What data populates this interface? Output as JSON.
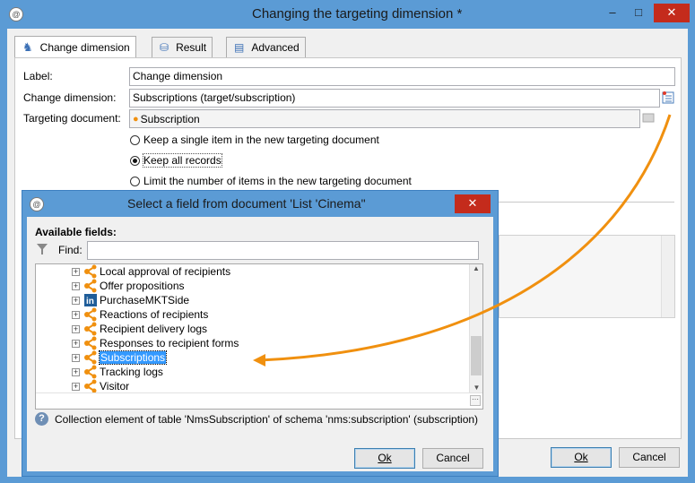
{
  "main_window": {
    "title": "Changing the targeting dimension *",
    "tabs": [
      {
        "label": "Change dimension"
      },
      {
        "label": "Result"
      },
      {
        "label": "Advanced"
      }
    ],
    "label_caption": "Label:",
    "label_value": "Change dimension",
    "change_dimension_caption": "Change dimension:",
    "change_dimension_value": "Subscriptions (target/subscription)",
    "targeting_document_caption": "Targeting document:",
    "targeting_document_value": "Subscription",
    "radio_options": [
      {
        "label": "Keep a single item in the new targeting document",
        "selected": false
      },
      {
        "label": "Keep all records",
        "selected": true
      },
      {
        "label": "Limit the number of items in the new targeting document",
        "selected": false
      }
    ],
    "ok_label": "Ok",
    "cancel_label": "Cancel"
  },
  "field_dialog": {
    "title": "Select a field from document 'List 'Cinema\"",
    "available_fields_caption": "Available fields:",
    "find_caption": "Find:",
    "find_value": "",
    "tree_items": [
      {
        "label": "Local approval of recipients",
        "icon": "link-icon",
        "selected": false
      },
      {
        "label": "Offer propositions",
        "icon": "link-icon",
        "selected": false
      },
      {
        "label": "PurchaseMKTSide",
        "icon": "linkedin-icon",
        "selected": false
      },
      {
        "label": "Reactions of recipients",
        "icon": "link-icon",
        "selected": false
      },
      {
        "label": "Recipient delivery logs",
        "icon": "link-icon",
        "selected": false
      },
      {
        "label": "Responses to recipient forms",
        "icon": "link-icon",
        "selected": false
      },
      {
        "label": "Subscriptions",
        "icon": "link-icon",
        "selected": true
      },
      {
        "label": "Tracking logs",
        "icon": "link-icon",
        "selected": false
      },
      {
        "label": "Visitor",
        "icon": "link-icon",
        "selected": false
      }
    ],
    "description": "Collection element of table 'NmsSubscription' of schema 'nms:subscription' (subscription)",
    "ok_label": "Ok",
    "cancel_label": "Cancel"
  },
  "colors": {
    "title_bar": "#5b9bd5",
    "close_button": "#c42b1c",
    "annotation_arrow": "#f0900f",
    "selection": "#3399ff"
  }
}
